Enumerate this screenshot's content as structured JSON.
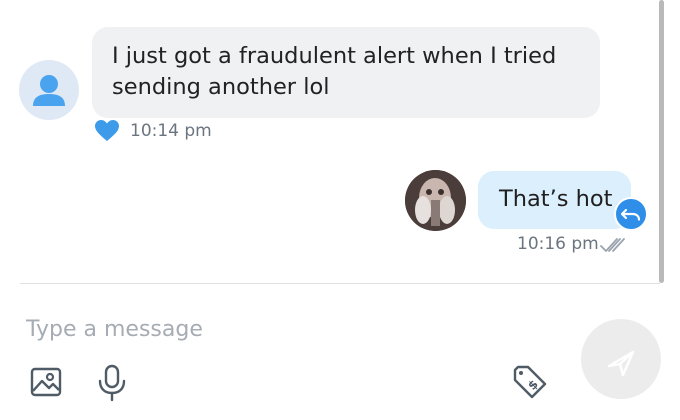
{
  "messages": [
    {
      "direction": "incoming",
      "text": "I just got a fraudulent alert when I tried sending another lol",
      "timestamp": "10:14 pm",
      "reaction": "heart-icon"
    },
    {
      "direction": "outgoing",
      "text": "That’s hot",
      "timestamp": "10:16 pm",
      "status": "read"
    }
  ],
  "composer": {
    "placeholder": "Type a message",
    "icons": [
      "image-icon",
      "microphone-icon",
      "price-tag-icon",
      "send-icon"
    ]
  },
  "colors": {
    "incoming_bubble": "#eff1f3",
    "outgoing_bubble": "#dceffd",
    "accent": "#2e8ee8",
    "timestamp": "#6b7580"
  }
}
